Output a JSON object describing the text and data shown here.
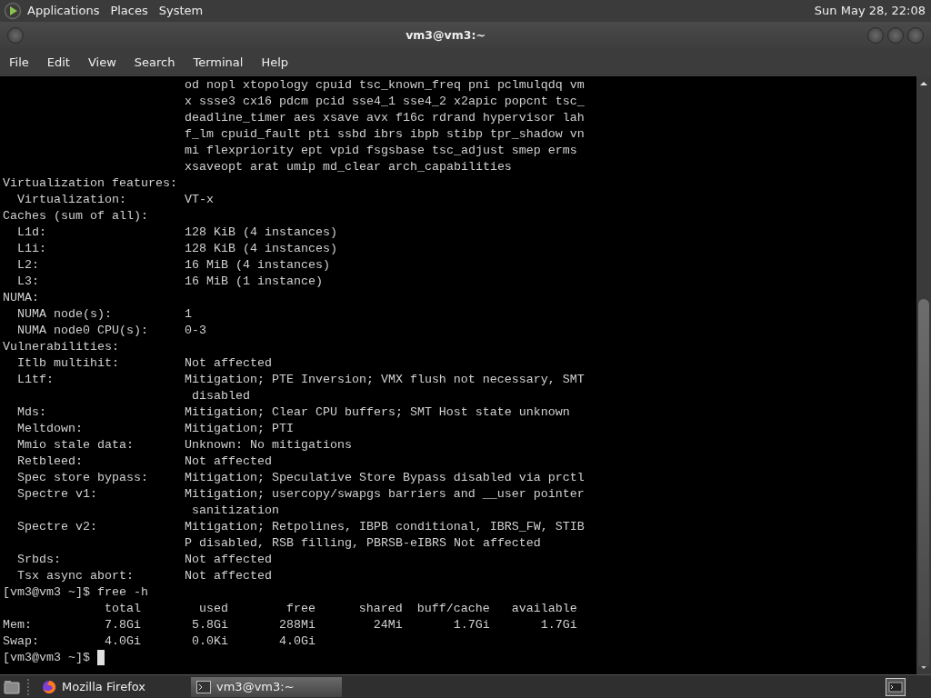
{
  "top_panel": {
    "menus": [
      "Applications",
      "Places",
      "System"
    ],
    "clock": "Sun May 28, 22:08"
  },
  "window": {
    "title": "vm3@vm3:~"
  },
  "menubar": [
    "File",
    "Edit",
    "View",
    "Search",
    "Terminal",
    "Help"
  ],
  "terminal": {
    "lines": [
      {
        "kind": "cont",
        "text": "od nopl xtopology cpuid tsc_known_freq pni pclmulqdq vm"
      },
      {
        "kind": "cont",
        "text": "x ssse3 cx16 pdcm pcid sse4_1 sse4_2 x2apic popcnt tsc_"
      },
      {
        "kind": "cont",
        "text": "deadline_timer aes xsave avx f16c rdrand hypervisor lah"
      },
      {
        "kind": "cont",
        "text": "f_lm cpuid_fault pti ssbd ibrs ibpb stibp tpr_shadow vn"
      },
      {
        "kind": "cont",
        "text": "mi flexpriority ept vpid fsgsbase tsc_adjust smep erms"
      },
      {
        "kind": "cont",
        "text": "xsaveopt arat umip md_clear arch_capabilities"
      },
      {
        "kind": "section",
        "text": "Virtualization features:"
      },
      {
        "kind": "field",
        "label": "Virtualization:",
        "value": "VT-x"
      },
      {
        "kind": "section",
        "text": "Caches (sum of all):"
      },
      {
        "kind": "field",
        "label": "L1d:",
        "value": "128 KiB (4 instances)"
      },
      {
        "kind": "field",
        "label": "L1i:",
        "value": "128 KiB (4 instances)"
      },
      {
        "kind": "field",
        "label": "L2:",
        "value": "16 MiB (4 instances)"
      },
      {
        "kind": "field",
        "label": "L3:",
        "value": "16 MiB (1 instance)"
      },
      {
        "kind": "section",
        "text": "NUMA:"
      },
      {
        "kind": "field",
        "label": "NUMA node(s):",
        "value": "1"
      },
      {
        "kind": "field",
        "label": "NUMA node0 CPU(s):",
        "value": "0-3"
      },
      {
        "kind": "section",
        "text": "Vulnerabilities:"
      },
      {
        "kind": "field",
        "label": "Itlb multihit:",
        "value": "Not affected"
      },
      {
        "kind": "field",
        "label": "L1tf:",
        "value": "Mitigation; PTE Inversion; VMX flush not necessary, SMT"
      },
      {
        "kind": "wrap",
        "text": "disabled"
      },
      {
        "kind": "field",
        "label": "Mds:",
        "value": "Mitigation; Clear CPU buffers; SMT Host state unknown"
      },
      {
        "kind": "field",
        "label": "Meltdown:",
        "value": "Mitigation; PTI"
      },
      {
        "kind": "field",
        "label": "Mmio stale data:",
        "value": "Unknown: No mitigations"
      },
      {
        "kind": "field",
        "label": "Retbleed:",
        "value": "Not affected"
      },
      {
        "kind": "field",
        "label": "Spec store bypass:",
        "value": "Mitigation; Speculative Store Bypass disabled via prctl"
      },
      {
        "kind": "field",
        "label": "Spectre v1:",
        "value": "Mitigation; usercopy/swapgs barriers and __user pointer"
      },
      {
        "kind": "wrap",
        "text": "sanitization"
      },
      {
        "kind": "field",
        "label": "Spectre v2:",
        "value": "Mitigation; Retpolines, IBPB conditional, IBRS_FW, STIB"
      },
      {
        "kind": "cont",
        "text": "P disabled, RSB filling, PBRSB-eIBRS Not affected"
      },
      {
        "kind": "field",
        "label": "Srbds:",
        "value": "Not affected"
      },
      {
        "kind": "field",
        "label": "Tsx async abort:",
        "value": "Not affected"
      },
      {
        "kind": "prompt",
        "prompt": "[vm3@vm3 ~]$",
        "command": "free -h"
      },
      {
        "kind": "table_header",
        "cells": [
          "total",
          "used",
          "free",
          "shared",
          "buff/cache",
          "available"
        ]
      },
      {
        "kind": "table_row",
        "label": "Mem:",
        "cells": [
          "7.8Gi",
          "5.8Gi",
          "288Mi",
          "24Mi",
          "1.7Gi",
          "1.7Gi"
        ]
      },
      {
        "kind": "table_row",
        "label": "Swap:",
        "cells": [
          "4.0Gi",
          "0.0Ki",
          "4.0Gi"
        ]
      },
      {
        "kind": "prompt",
        "prompt": "[vm3@vm3 ~]$",
        "cursor": true
      }
    ]
  },
  "taskbar": {
    "tasks": [
      {
        "kind": "browser",
        "label": "Mozilla Firefox",
        "selected": false
      },
      {
        "kind": "terminal",
        "label": "vm3@vm3:~",
        "selected": true
      }
    ]
  }
}
